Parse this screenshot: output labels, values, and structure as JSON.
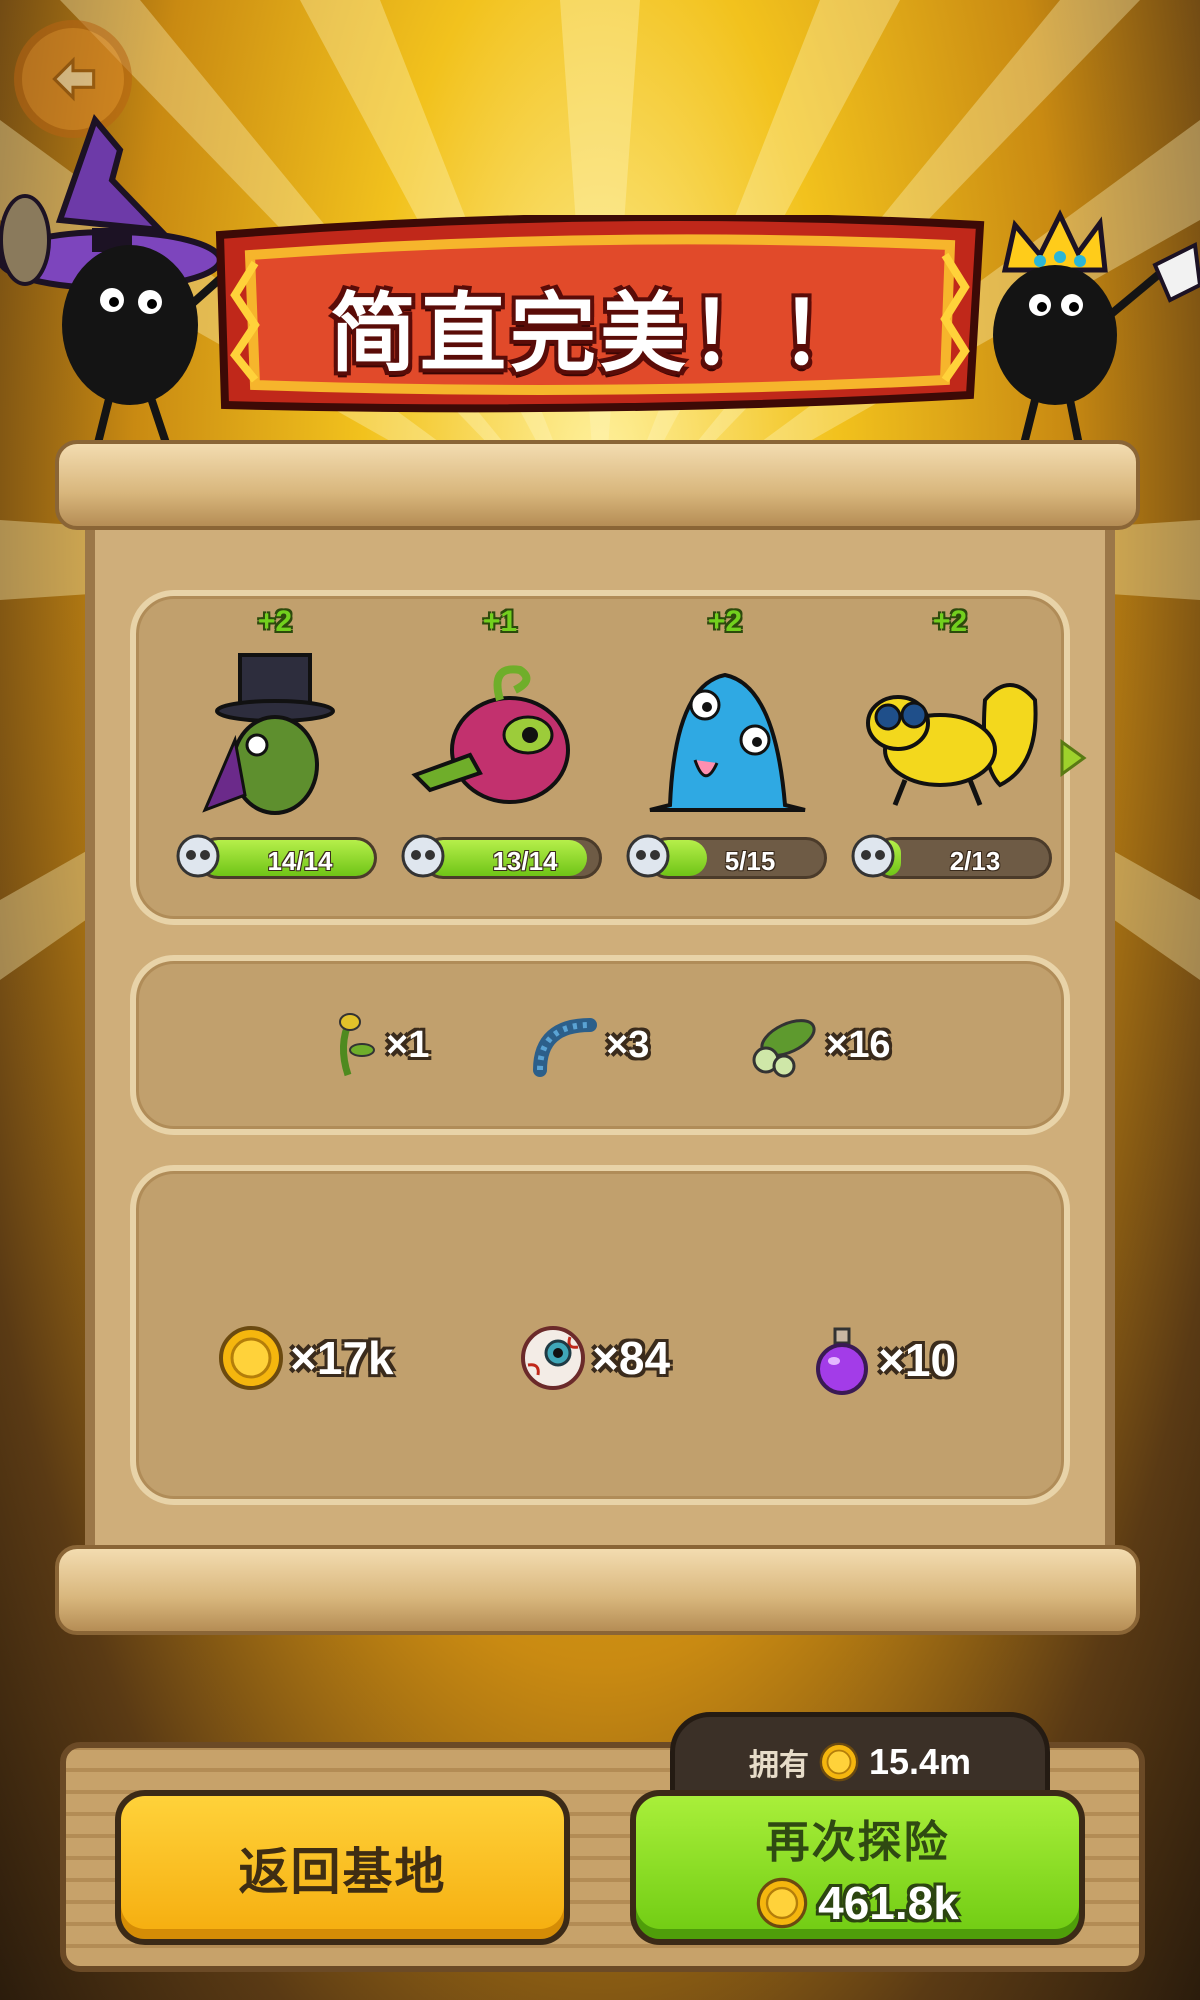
{
  "banner": {
    "title": "简直完美！！"
  },
  "monsters": [
    {
      "plus": "+2",
      "xp": "14/14",
      "progress": 1.0,
      "icon": "top-hat-cactus-icon"
    },
    {
      "plus": "+1",
      "xp": "13/14",
      "progress": 0.93,
      "icon": "pink-bird-monster-icon"
    },
    {
      "plus": "+2",
      "xp": "5/15",
      "progress": 0.33,
      "icon": "blue-slime-monster-icon"
    },
    {
      "plus": "+2",
      "xp": "2/13",
      "progress": 0.15,
      "icon": "yellow-gecko-monster-icon"
    }
  ],
  "materials": [
    {
      "icon": "flower-stem-icon",
      "qty": "×1"
    },
    {
      "icon": "blue-caterpillar-icon",
      "qty": "×3"
    },
    {
      "icon": "cucumber-icon",
      "qty": "×16"
    }
  ],
  "rewards": [
    {
      "icon": "gold-coin-icon",
      "qty": "×17k"
    },
    {
      "icon": "eyeball-icon",
      "qty": "×84"
    },
    {
      "icon": "purple-potion-icon",
      "qty": "×10"
    }
  ],
  "owned": {
    "label": "拥有",
    "value": "15.4m"
  },
  "buttons": {
    "return_label": "返回基地",
    "again_label": "再次探险",
    "again_cost": "461.8k"
  },
  "colors": {
    "accent_green": "#72d01e",
    "button_yellow": "#f5ad0e",
    "button_green": "#6fcb12",
    "banner_red": "#c0281a"
  }
}
